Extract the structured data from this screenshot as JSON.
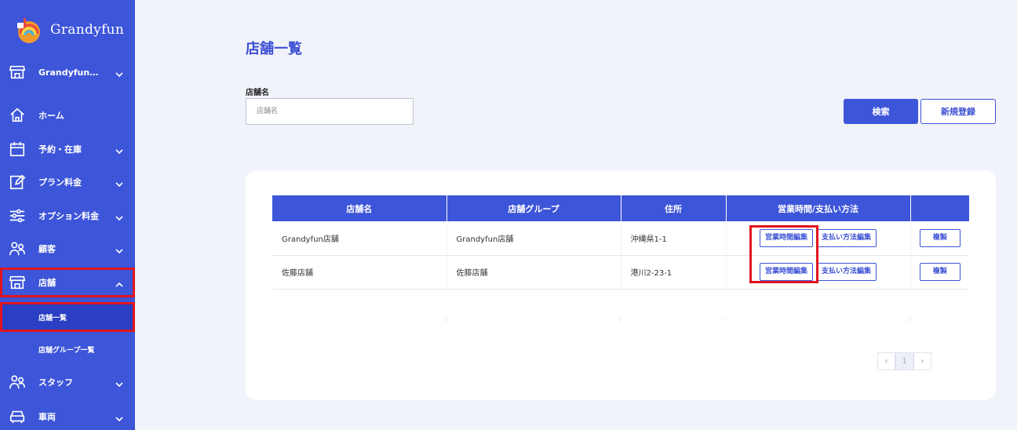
{
  "app": {
    "logo_text": "Grandyfun"
  },
  "sidebar": {
    "store_select": "Grandyfun…",
    "items": [
      {
        "label": "ホーム"
      },
      {
        "label": "予約・在庫"
      },
      {
        "label": "プラン料金"
      },
      {
        "label": "オプション料金"
      },
      {
        "label": "顧客"
      },
      {
        "label": "店舗"
      },
      {
        "label": "スタッフ"
      },
      {
        "label": "車両"
      }
    ],
    "sub_items": [
      {
        "label": "店舗一覧"
      },
      {
        "label": "店舗グループ一覧"
      }
    ]
  },
  "main": {
    "title": "店舗一覧",
    "filter_label": "店舗名",
    "filter_placeholder": "店舗名",
    "search_button": "検索",
    "new_button": "新規登録",
    "table": {
      "headers": [
        "店舗名",
        "店舗グループ",
        "住所",
        "営業時間/支払い方法",
        ""
      ],
      "rows": [
        {
          "name": "Grandyfun店舗",
          "group": "Grandyfun店舗",
          "address": "沖縄県1-1",
          "hours_btn": "営業時間編集",
          "pay_btn": "支払い方法編集",
          "copy_btn": "複製"
        },
        {
          "name": "佐藤店舗",
          "group": "佐藤店舗",
          "address": "港川2-23-1",
          "hours_btn": "営業時間編集",
          "pay_btn": "支払い方法編集",
          "copy_btn": "複製"
        }
      ]
    },
    "pagination": {
      "prev": "‹",
      "current": "1",
      "next": "›"
    }
  },
  "colors": {
    "primary": "#3d55d8",
    "highlight": "#e0141e",
    "background": "#f1f3fa"
  }
}
